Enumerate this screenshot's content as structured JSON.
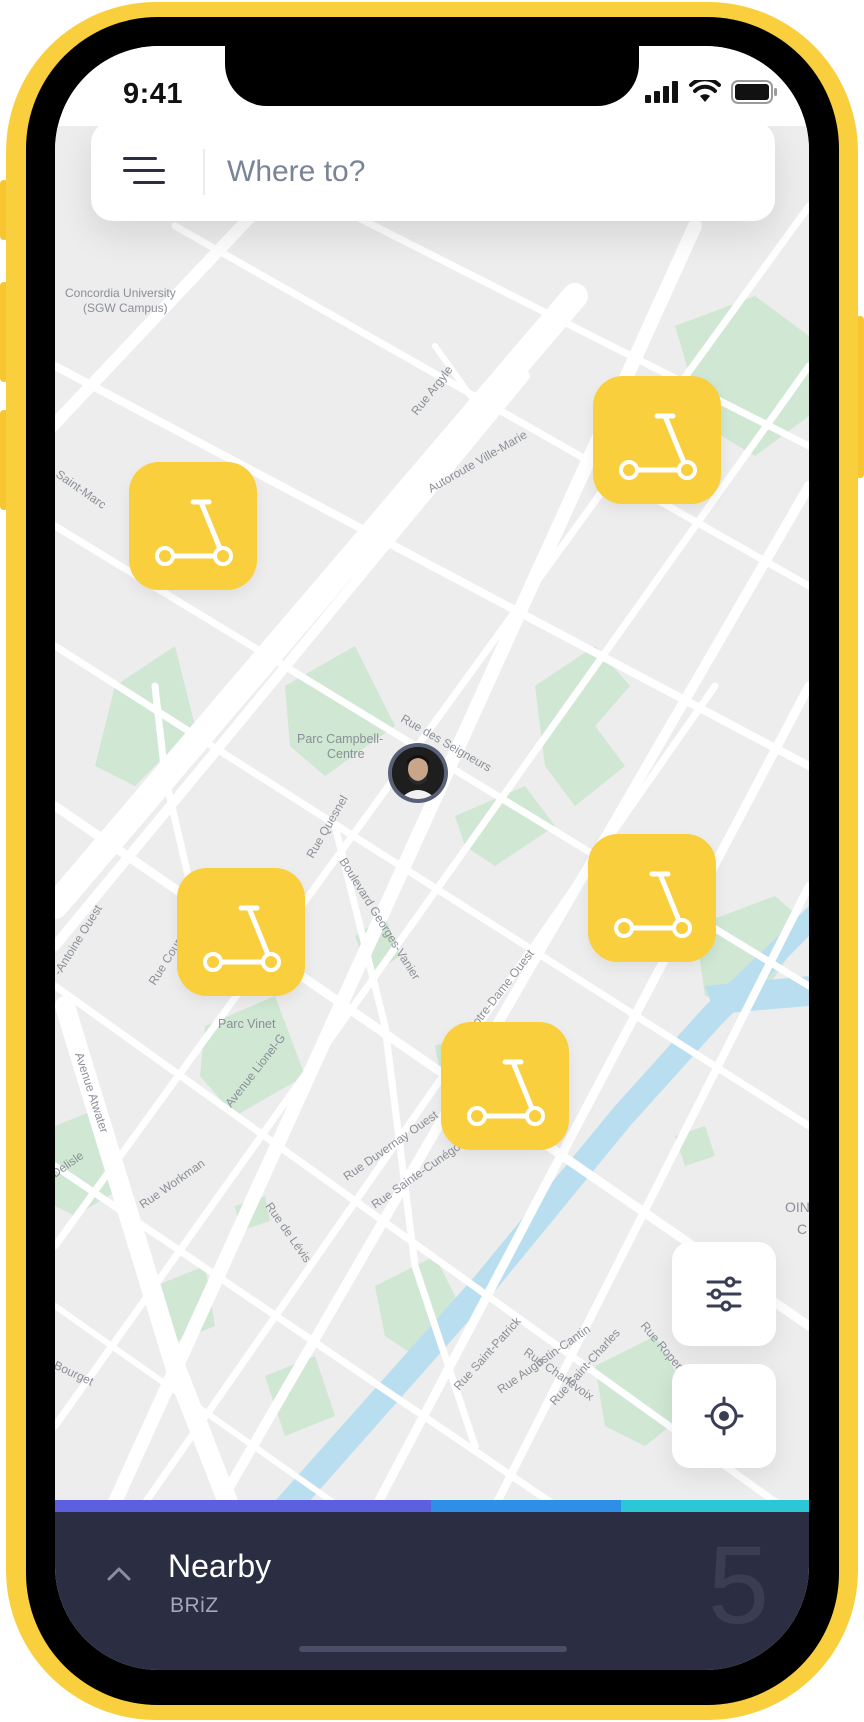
{
  "status_bar": {
    "time": "9:41",
    "signal_icon": "signal-bars-icon",
    "wifi_icon": "wifi-icon",
    "battery_icon": "battery-icon"
  },
  "search": {
    "placeholder": "Where to?",
    "menu_icon": "menu-icon"
  },
  "map": {
    "labels": {
      "concordia1": "Concordia University",
      "concordia2": "(SGW Campus)",
      "rue_argyle": "Rue Argyle",
      "autoroute": "Autoroute Ville-Marie",
      "saint_marc": "Saint-Marc",
      "parc_campbell1": "Parc Campbell-",
      "parc_campbell2": "Centre",
      "rue_seigneurs": "Rue des Seigneurs",
      "rue_quesnel": "Rue Quesnel",
      "antoine_ouest": "-Antoine Ouest",
      "rue_coursol": "Rue Coursol",
      "georges_vanier": "Boulevard Georges-Vanier",
      "notre_dame": "Rue Notre-Dame Ouest",
      "lionel": "Avenue Lionel-G",
      "parc_vinet": "Parc Vinet",
      "atwater": "Avenue Atwater",
      "duvernay": "Rue Duvernay Ouest",
      "cunegonde": "Rue Sainte-Cunégonde",
      "delisle": "Delisle",
      "workman": "Rue Workman",
      "levis": "Rue de Lévis",
      "saint_patrick": "Rue Saint-Patrick",
      "augustin": "Rue Augustin-Cantin",
      "saint_charles": "Rue Saint-Charles",
      "ropery": "Rue Ropery",
      "charlevoix": "Rue Charlevoix",
      "bourget": "Bourget",
      "pointe1": "OIN",
      "pointe2": "C"
    }
  },
  "markers": [
    {
      "id": "scooter-1",
      "icon": "scooter-icon"
    },
    {
      "id": "scooter-2",
      "icon": "scooter-icon"
    },
    {
      "id": "scooter-3",
      "icon": "scooter-icon"
    },
    {
      "id": "scooter-4",
      "icon": "scooter-icon"
    },
    {
      "id": "scooter-5",
      "icon": "scooter-icon"
    }
  ],
  "controls": {
    "filter_icon": "sliders-icon",
    "locate_icon": "target-icon"
  },
  "progress_colors": [
    "#5b5fe0",
    "#5b5fe0",
    "#2f8fe6",
    "#2bc7d6"
  ],
  "bottom_sheet": {
    "title": "Nearby",
    "subtitle": "BRiZ",
    "count": "5",
    "chevron_icon": "chevron-up-icon"
  },
  "colors": {
    "accent": "#f9cf3e",
    "sheet": "#2b2e42",
    "water": "#b9def0",
    "park": "#cfe7d3"
  }
}
